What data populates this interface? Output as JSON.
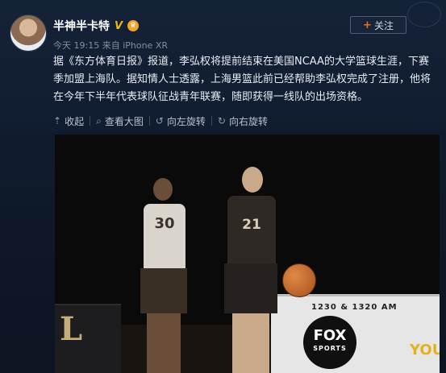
{
  "post": {
    "author": "半神半卡特",
    "verified_badge": "V",
    "crown_icon": "crown-icon",
    "time": "今天 19:15",
    "source": "来自 iPhone XR",
    "follow_plus": "+",
    "follow_label": "关注",
    "text": "据《东方体育日报》报道，李弘权将提前结束在美国NCAA的大学篮球生涯，下赛季加盟上海队。据知情人士透露，上海男篮此前已经帮助李弘权完成了注册，他将在今年下半年代表球队征战青年联赛，随即获得一线队的出场资格。",
    "actions": [
      {
        "label": "收起",
        "icon": "collapse-icon",
        "glyph": "⇡"
      },
      {
        "label": "查看大图",
        "icon": "zoom-icon",
        "glyph": "⌕"
      },
      {
        "label": "向左旋转",
        "icon": "rotate-left-icon",
        "glyph": "↺"
      },
      {
        "label": "向右旋转",
        "icon": "rotate-right-icon",
        "glyph": "↻"
      }
    ]
  },
  "photo": {
    "jersey_left": "30",
    "jersey_right": "21",
    "board_left_letter": "L",
    "fox_top": "1230 & 1320 AM",
    "fox_line1": "FOX",
    "fox_line2": "SPORTS",
    "board_right_text": "YOU"
  }
}
